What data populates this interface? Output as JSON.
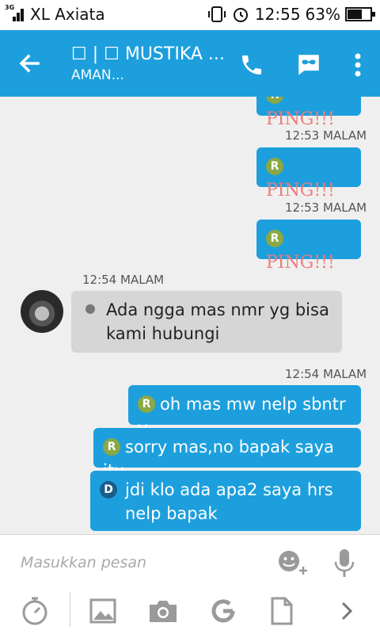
{
  "status_bar": {
    "network_type": "3G",
    "carrier": "XL Axiata",
    "time": "12:55",
    "battery_percent": "63%",
    "battery_level": 0.63
  },
  "header": {
    "title": "☐ | ☐ MUSTIKA ...",
    "subtitle": "AMAN...",
    "icons": [
      "back-arrow-icon",
      "phone-icon",
      "chat-mask-icon",
      "more-vert-icon"
    ]
  },
  "messages": [
    {
      "direction": "out",
      "badge": "R",
      "text": "PING!!!",
      "timestamp": ""
    },
    {
      "direction": "out",
      "badge": "R",
      "text": "PING!!!",
      "timestamp": "12:53 MALAM"
    },
    {
      "direction": "out",
      "badge": "R",
      "text": "PING!!!",
      "timestamp": "12:53 MALAM"
    },
    {
      "direction": "in",
      "badge": "",
      "text": "Ada ngga mas nmr yg bisa kami hubungi",
      "timestamp": "12:54 MALAM"
    },
    {
      "direction": "out",
      "badge": "R",
      "text": "oh mas mw nelp sbntr y",
      "timestamp": "12:54 MALAM"
    },
    {
      "direction": "out",
      "badge": "R",
      "text": "sorry mas,no bapak saya itu",
      "timestamp": ""
    },
    {
      "direction": "out",
      "badge": "D",
      "text": "jdi klo ada apa2 saya hrs nelp bapak",
      "timestamp": ""
    }
  ],
  "composer": {
    "placeholder": "Masukkan pesan",
    "value": ""
  },
  "toolbar": {
    "icons": [
      "timer-icon",
      "image-icon",
      "camera-icon",
      "refresh-g-icon",
      "file-icon",
      "chevron-right-icon"
    ]
  },
  "colors": {
    "accent": "#1d9fdd",
    "incoming_bubble": "#d6d6d6",
    "ping_text": "#f07a7a",
    "badge_read": "#8aa844",
    "badge_delivered": "#1a5d8a"
  }
}
